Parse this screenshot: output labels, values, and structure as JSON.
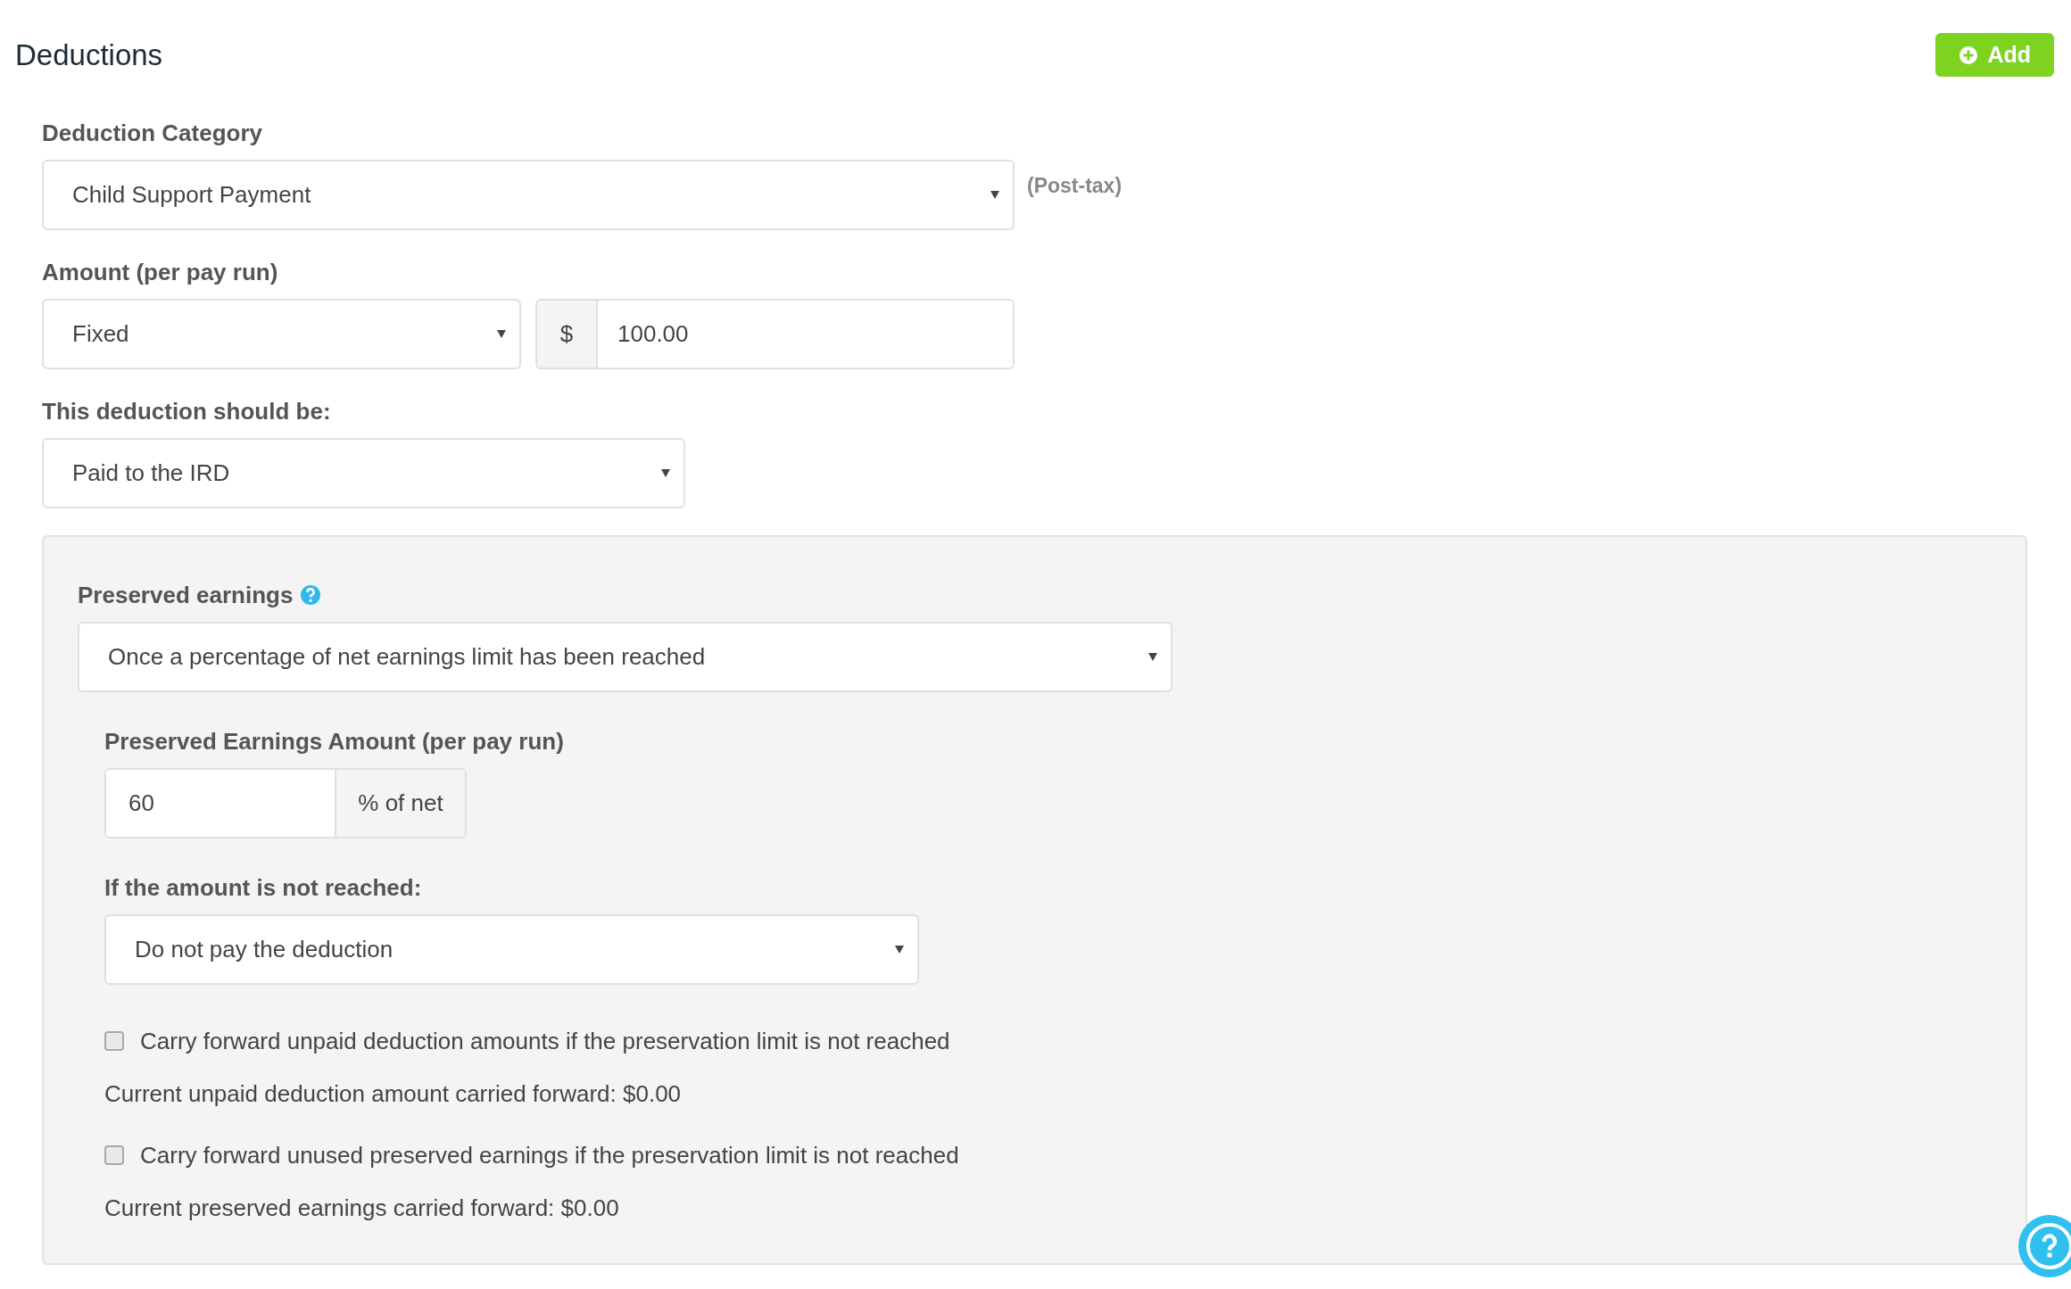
{
  "title": "Deductions",
  "add_button": {
    "label": "Add"
  },
  "category": {
    "label": "Deduction Category",
    "value": "Child Support Payment",
    "note": "(Post-tax)"
  },
  "amount": {
    "label": "Amount (per pay run)",
    "type_value": "Fixed",
    "prefix": "$",
    "value": "100.00"
  },
  "destination": {
    "label": "This deduction should be:",
    "value": "Paid to the IRD"
  },
  "preserved": {
    "label": "Preserved earnings",
    "mode_value": "Once a percentage of net earnings limit has been reached",
    "amount_label": "Preserved Earnings Amount (per pay run)",
    "amount_value": "60",
    "amount_suffix": "% of net",
    "fallback_label": "If the amount is not reached:",
    "fallback_value": "Do not pay the deduction",
    "options": [
      {
        "label": "Carry forward unpaid deduction amounts if the preservation limit is not reached",
        "checked": false,
        "note": "Current unpaid deduction amount carried forward: $0.00"
      },
      {
        "label": "Carry forward unused preserved earnings if the preservation limit is not reached",
        "checked": false,
        "note": "Current preserved earnings carried forward: $0.00"
      }
    ]
  }
}
